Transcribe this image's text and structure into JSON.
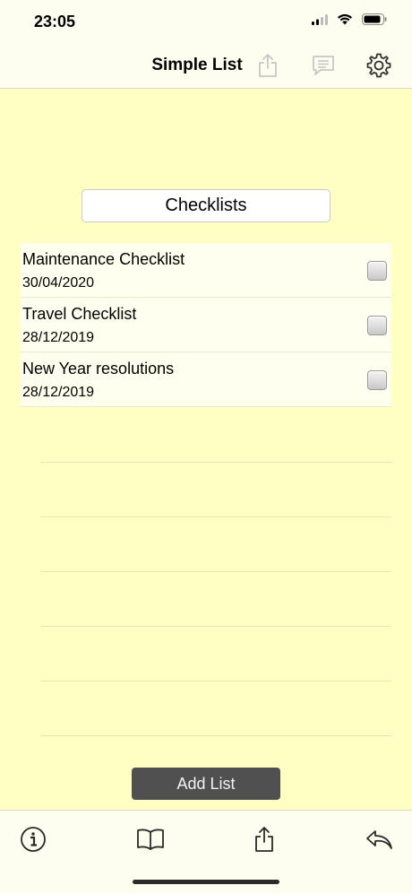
{
  "status": {
    "time": "23:05"
  },
  "nav": {
    "title": "Simple List",
    "icons": [
      "share-icon",
      "comment-icon",
      "gear-icon"
    ]
  },
  "header": {
    "label": "Checklists"
  },
  "items": [
    {
      "title": "Maintenance Checklist",
      "date": "30/04/2020",
      "checked": false
    },
    {
      "title": "Travel Checklist",
      "date": "28/12/2019",
      "checked": false
    },
    {
      "title": "New Year resolutions",
      "date": "28/12/2019",
      "checked": false
    }
  ],
  "add_button": {
    "label": "Add List"
  },
  "toolbar": {
    "icons": [
      "info-icon",
      "book-icon",
      "share-icon",
      "reply-icon"
    ]
  },
  "colors": {
    "background": "#ffffc4",
    "bar": "#fdfdf0",
    "button": "#505050"
  }
}
